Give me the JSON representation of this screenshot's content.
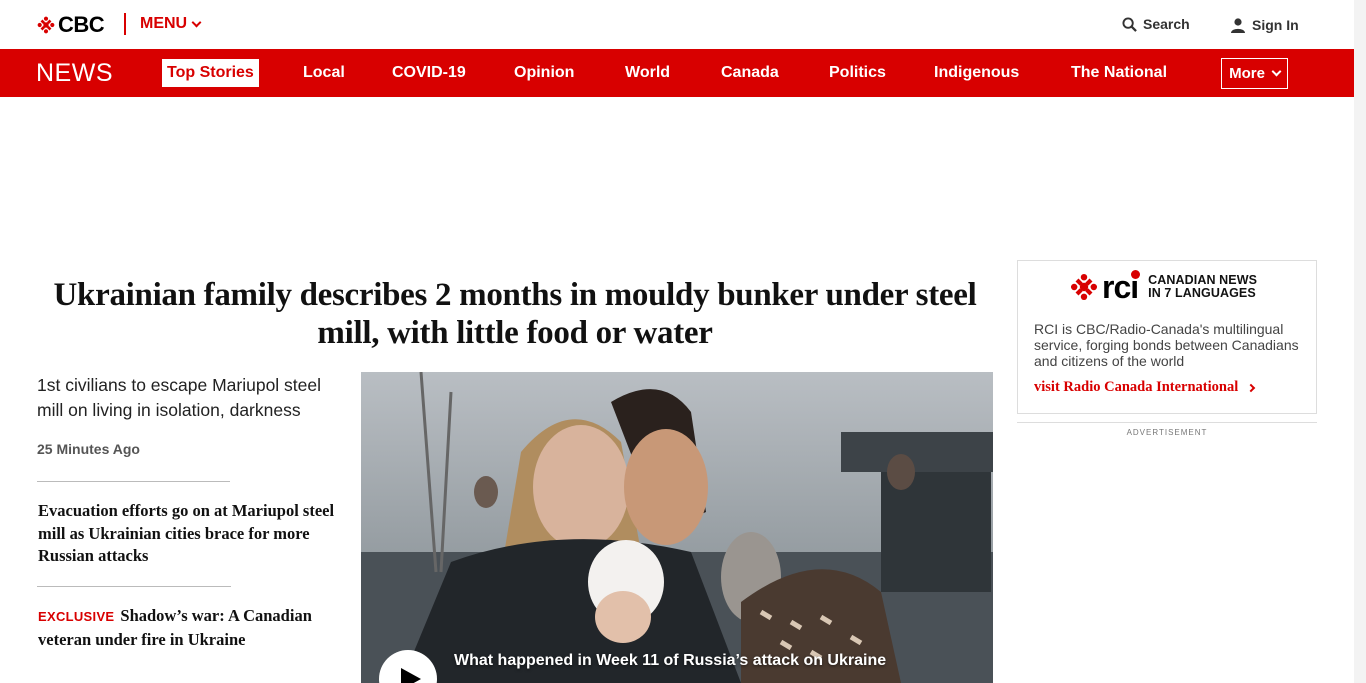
{
  "header": {
    "logo_text": "CBC",
    "menu_label": "MENU",
    "search_label": "Search",
    "signin_label": "Sign In"
  },
  "nav": {
    "section_title": "NEWS",
    "items": [
      {
        "label": "Top Stories",
        "active": true
      },
      {
        "label": "Local"
      },
      {
        "label": "COVID-19"
      },
      {
        "label": "Opinion"
      },
      {
        "label": "World"
      },
      {
        "label": "Canada"
      },
      {
        "label": "Politics"
      },
      {
        "label": "Indigenous"
      },
      {
        "label": "The National"
      }
    ],
    "more_label": "More"
  },
  "lead": {
    "headline": "Ukrainian family describes 2 months in mouldy bunker under steel mill, with little food or water",
    "deck": "1st civilians to escape Mariupol steel mill on living in isolation, darkness",
    "timestamp": "25 Minutes Ago",
    "video_caption": "What happened in Week 11 of Russia’s attack on Ukraine"
  },
  "related": [
    {
      "title": "Evacuation efforts go on at Mariupol steel mill as Ukrainian cities brace for more Russian attacks"
    },
    {
      "badge": "EXCLUSIVE",
      "title": "Shadow’s war: A Canadian veteran under fire in Ukraine"
    }
  ],
  "rci": {
    "logo_text": "rci",
    "tagline_1": "CANADIAN NEWS",
    "tagline_2": "IN 7 LANGUAGES",
    "description": "RCI is CBC/Radio-Canada's multilingual service, forging bonds between Canadians and citizens of the world",
    "link_label": "visit Radio Canada International"
  },
  "ad_label": "ADVERTISEMENT",
  "colors": {
    "brand_red": "#d80000",
    "text": "#111111",
    "muted": "#555555"
  }
}
